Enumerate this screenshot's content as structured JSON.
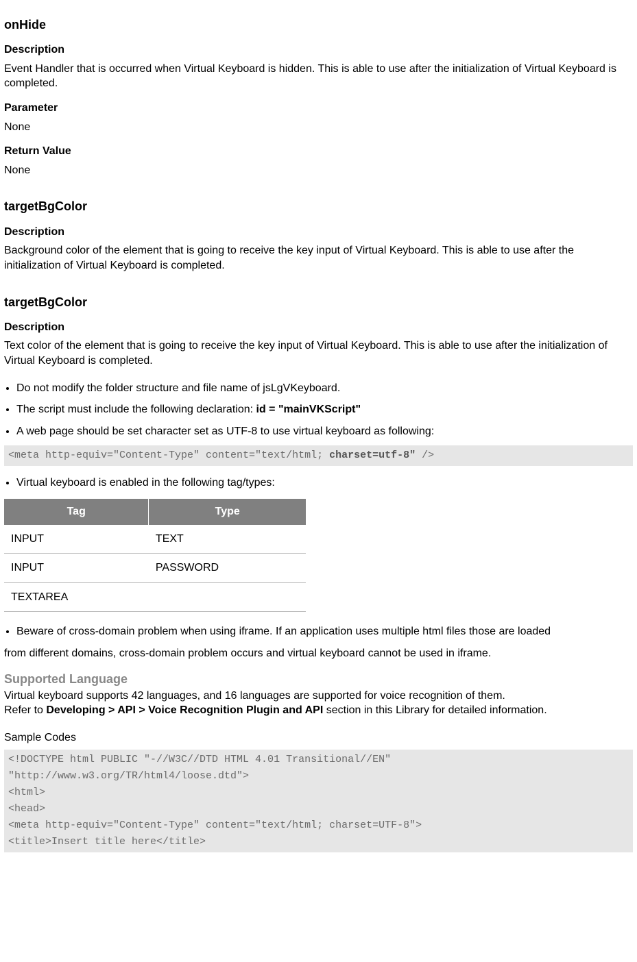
{
  "onHide": {
    "title": "onHide",
    "descLabel": "Description",
    "descText": "Event Handler that is occurred when Virtual Keyboard is hidden. This is able to use after the initialization of Virtual Keyboard is completed.",
    "paramLabel": "Parameter",
    "paramText": "None",
    "returnLabel": "Return Value",
    "returnText": "None"
  },
  "targetBgColor1": {
    "title": "targetBgColor",
    "descLabel": "Description",
    "descText": "Background color of the element that is going to receive the key input of Virtual Keyboard. This is able to use after the initialization of Virtual Keyboard is completed."
  },
  "targetBgColor2": {
    "title": "targetBgColor",
    "descLabel": "Description",
    "descText": "Text color of the element that is going to receive the key input of Virtual Keyboard. This is able to use after the initialization of Virtual Keyboard is completed."
  },
  "notes": {
    "item1": "Do not modify the folder structure and file name of jsLgVKeyboard.",
    "item2_pre": "The script must include the following declaration: ",
    "item2_bold": "id = \"mainVKScript\"",
    "item3": "A web page should be set character set as UTF-8 to use virtual keyboard as following:"
  },
  "metaCode": {
    "pre": "<meta http-equiv=\"Content-Type\" content=\"text/html; ",
    "bold": "charset=utf-8\"",
    "post": " />"
  },
  "notes2": {
    "item1": "Virtual keyboard is enabled in the following tag/types:"
  },
  "table": {
    "headers": {
      "col1": "Tag",
      "col2": "Type"
    },
    "rows": [
      {
        "tag": "INPUT",
        "type": "TEXT"
      },
      {
        "tag": "INPUT",
        "type": "PASSWORD"
      },
      {
        "tag": "TEXTAREA",
        "type": ""
      }
    ]
  },
  "notes3": {
    "item1_bullet": "Beware of cross-domain problem when using iframe. If an application uses multiple html files those are loaded",
    "item1_cont": "from different domains, cross-domain problem occurs and virtual keyboard cannot be used in iframe."
  },
  "supported": {
    "title": "Supported Language",
    "line1": "Virtual keyboard supports 42 languages, and 16 languages are supported for voice recognition of them.",
    "line2_pre": "Refer to ",
    "line2_bold": "Developing > API > Voice Recognition Plugin and API",
    "line2_post": " section in this Library for detailed information."
  },
  "sample": {
    "label": "Sample Codes",
    "code": "<!DOCTYPE html PUBLIC \"-//W3C//DTD HTML 4.01 Transitional//EN\"\n\"http://www.w3.org/TR/html4/loose.dtd\">\n<html>\n<head>\n<meta http-equiv=\"Content-Type\" content=\"text/html; charset=UTF-8\">\n<title>Insert title here</title>"
  }
}
